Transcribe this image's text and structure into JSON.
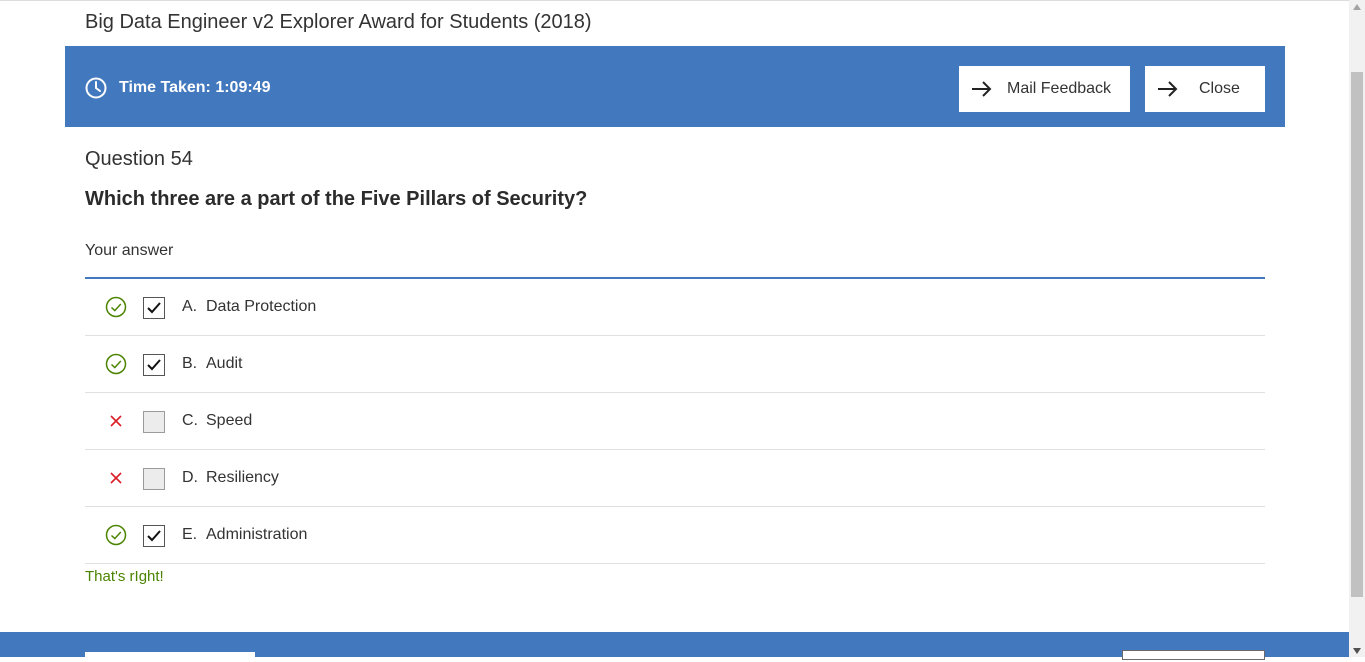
{
  "page": {
    "title": "Big Data Engineer v2 Explorer Award for Students (2018)"
  },
  "header": {
    "time_taken": "Time Taken: 1:09:49",
    "mail_feedback_label": "Mail Feedback",
    "close_label": "Close",
    "bar_color": "#4178be"
  },
  "question": {
    "number_label": "Question 54",
    "text": "Which three are a part of the Five Pillars of Security?",
    "your_answer_label": "Your answer",
    "options": [
      {
        "letter": "A.",
        "label": "Data Protection",
        "checked": true,
        "status": "correct-check-icon"
      },
      {
        "letter": "B.",
        "label": "Audit",
        "checked": true,
        "status": "correct-check-icon"
      },
      {
        "letter": "C.",
        "label": "Speed",
        "checked": false,
        "status": "incorrect-x-icon"
      },
      {
        "letter": "D.",
        "label": "Resiliency",
        "checked": false,
        "status": "incorrect-x-icon"
      },
      {
        "letter": "E.",
        "label": "Administration",
        "checked": true,
        "status": "correct-check-icon"
      }
    ],
    "feedback": "That's rIght!",
    "feedback_color": "#4b8400",
    "correct_color": "#4b8400",
    "incorrect_color": "#da1e28"
  }
}
